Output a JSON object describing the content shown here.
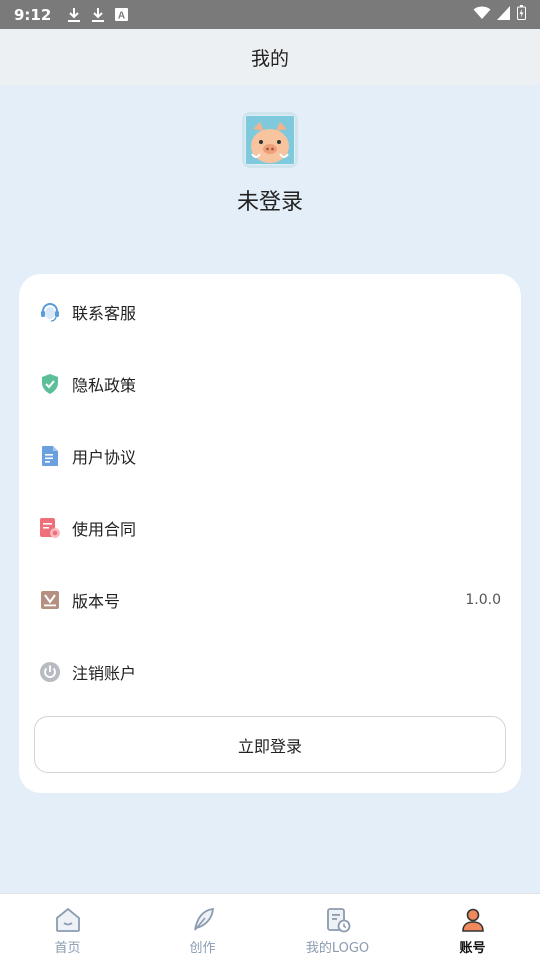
{
  "status_bar": {
    "time": "9:12",
    "left_icons": [
      "download-icon",
      "download-icon",
      "font-a-icon"
    ],
    "right_icons": [
      "wifi-icon",
      "signal-icon",
      "battery-icon"
    ]
  },
  "header": {
    "title": "我的"
  },
  "profile": {
    "avatar_icon": "pig-avatar-icon",
    "name": "未登录"
  },
  "menu": {
    "items": [
      {
        "icon": "headset-icon",
        "label": "联系客服",
        "value": "",
        "color": "#5b9bd8"
      },
      {
        "icon": "shield-check-icon",
        "label": "隐私政策",
        "value": "",
        "color": "#5bbf9a"
      },
      {
        "icon": "document-icon",
        "label": "用户协议",
        "value": "",
        "color": "#6a9fe0"
      },
      {
        "icon": "contract-icon",
        "label": "使用合同",
        "value": "",
        "color": "#ef6f7a"
      },
      {
        "icon": "version-icon",
        "label": "版本号",
        "value": "1.0.0",
        "color": "#b58f80"
      },
      {
        "icon": "power-icon",
        "label": "注销账户",
        "value": "",
        "color": "#b8bcc2"
      }
    ]
  },
  "login_button": {
    "label": "立即登录"
  },
  "tab_bar": {
    "tabs": [
      {
        "icon": "home-icon",
        "label": "首页",
        "active": false
      },
      {
        "icon": "feather-icon",
        "label": "创作",
        "active": false
      },
      {
        "icon": "logo-history-icon",
        "label": "我的LOGO",
        "active": false
      },
      {
        "icon": "account-icon",
        "label": "账号",
        "active": true
      }
    ],
    "inactive_color": "#8b9bb0",
    "active_color": "#111111"
  }
}
